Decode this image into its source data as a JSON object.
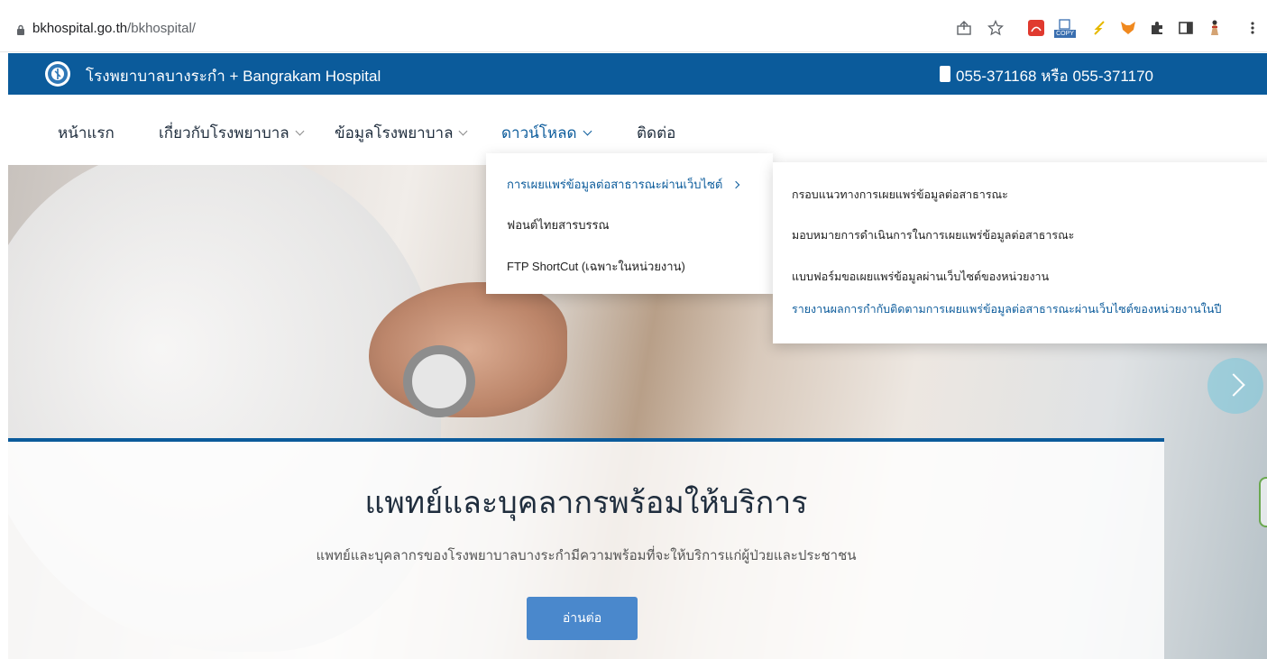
{
  "browser": {
    "url_host": "bkhospital.go.th",
    "url_path": "/bkhospital/",
    "extensions": [
      "share-icon",
      "star-icon",
      "pdf-icon",
      "copy-icon",
      "bolt-icon",
      "fox-icon",
      "puzzle-icon",
      "sidepanel-icon",
      "avatar-icon",
      "more-icon"
    ],
    "copy_badge": "COPY"
  },
  "topbar": {
    "brand": "โรงพยาบาลบางระกำ + Bangrakam Hospital",
    "phone": "055-371168 หรือ 055-371170",
    "bg_color": "#0b5b9b"
  },
  "nav": {
    "items": [
      {
        "label": "หน้าแรก",
        "has_dropdown": false
      },
      {
        "label": "เกี่ยวกับโรงพยาบาล",
        "has_dropdown": true
      },
      {
        "label": "ข้อมูลโรงพยาบาล",
        "has_dropdown": true
      },
      {
        "label": "ดาวน์โหลด",
        "has_dropdown": true,
        "active": true
      },
      {
        "label": "ติดต่อ",
        "has_dropdown": false
      }
    ]
  },
  "dropdown": {
    "items": [
      {
        "label": "การเผยแพร่ข้อมูลต่อสาธารณะผ่านเว็บไซต์",
        "active": true
      },
      {
        "label": "ฟอนต์ไทยสารบรรณ"
      },
      {
        "label": "FTP ShortCut (เฉพาะในหน่วยงาน)"
      }
    ]
  },
  "submenu": {
    "items": [
      {
        "label": "กรอบแนวทางการเผยแพร่ข้อมูลต่อสาธารณะ"
      },
      {
        "label": "มอบหมายการดำเนินการในการเผยแพร่ข้อมูลต่อสาธารณะ"
      },
      {
        "label": "แบบฟอร์มขอเผยแพร่ข้อมูลผ่านเว็บไซต์ของหน่วยงาน"
      },
      {
        "label": "รายงานผลการกำกับติดตามการเผยแพร่ข้อมูลต่อสาธารณะผ่านเว็บไซต์ของหน่วยงานในปี",
        "active": true
      }
    ]
  },
  "hero": {
    "title": "แพทย์และบุคลากรพร้อมให้บริการ",
    "subtitle": "แพทย์และบุคลากรของโรงพยาบาลบางระกำมีความพร้อมที่จะให้บริการแก่ผู้ป่วยและประชาชน",
    "button": "อ่านต่อ",
    "accent_color": "#4a88cc"
  }
}
